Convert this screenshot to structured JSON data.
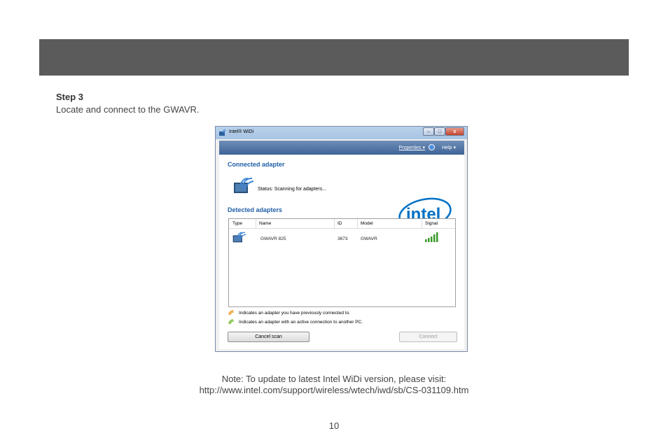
{
  "step": {
    "title": "Step 3",
    "description": "Locate and connect to the GWAVR."
  },
  "window": {
    "title": "Intel® WiDi",
    "controls": {
      "minimize": "–",
      "maximize": "□",
      "close": "x"
    }
  },
  "menu": {
    "properties": "Properties",
    "help": "Help"
  },
  "connected": {
    "heading": "Connected adapter",
    "status": "Status: Scanning for adapters..."
  },
  "logo": {
    "text": "intel"
  },
  "detected": {
    "heading": "Detected adapters",
    "columns": [
      "Type",
      "Name",
      "ID",
      "Model",
      "Signal"
    ],
    "rows": [
      {
        "name": "GWAVR 825",
        "id": "3673",
        "model": "GWAVR",
        "signal_bars": 5
      }
    ]
  },
  "legend": {
    "previous": "Indicates an adapter you have previously connected to.",
    "active": "Indicates an adapter with an active connection to another PC."
  },
  "buttons": {
    "cancel_scan": "Cancel scan",
    "connect": "Connect"
  },
  "note": {
    "line1": "Note: To update to latest Intel WiDi version, please visit:",
    "line2": "http://www.intel.com/support/wireless/wtech/iwd/sb/CS-031109.htm"
  },
  "page_number": "10",
  "colors": {
    "banner": "#5b5b5b",
    "heading_blue": "#1f5fa8",
    "intel_blue": "#0071c5",
    "signal_green": "#3a9a2a",
    "legend_orange": "#f0a030",
    "legend_green": "#7cc040"
  },
  "icons": [
    "widi-adapter-icon",
    "signal-bars-icon",
    "help-circle-icon",
    "dropdown-arrow-icon"
  ]
}
